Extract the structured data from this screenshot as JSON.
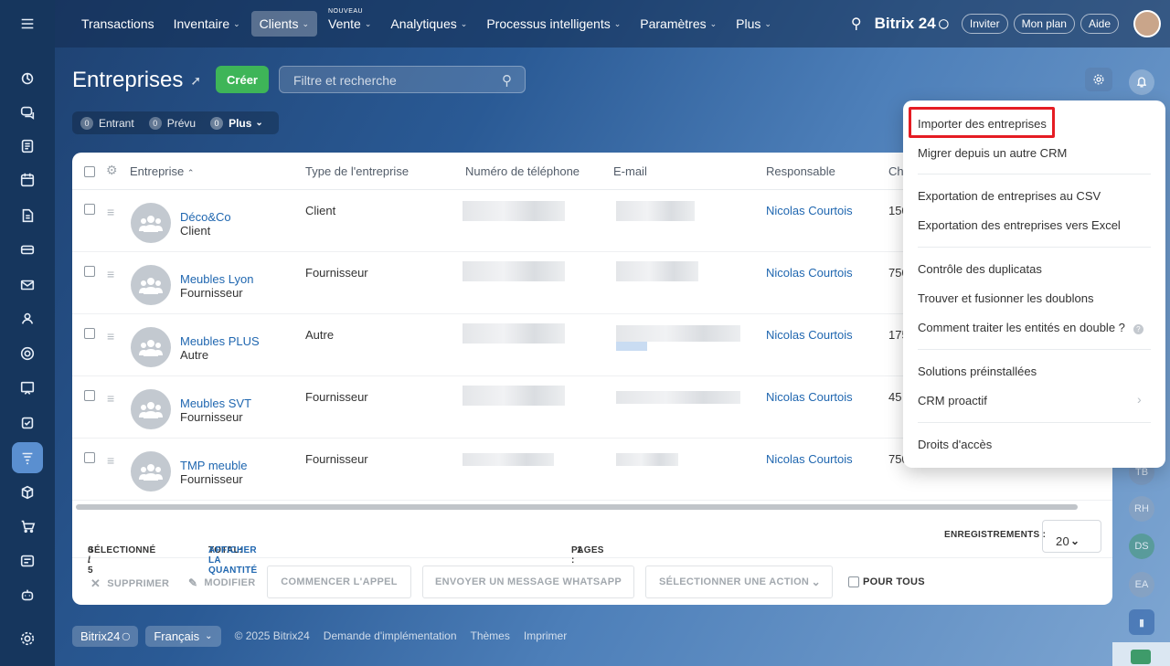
{
  "topnav": {
    "items": [
      {
        "label": "Transactions",
        "chevron": false
      },
      {
        "label": "Inventaire",
        "chevron": true
      },
      {
        "label": "Clients",
        "chevron": true,
        "active": true
      },
      {
        "label": "Vente",
        "chevron": true,
        "badge": "NOUVEAU"
      },
      {
        "label": "Analytiques",
        "chevron": true
      },
      {
        "label": "Processus intelligents",
        "chevron": true
      },
      {
        "label": "Paramètres",
        "chevron": true
      },
      {
        "label": "Plus",
        "chevron": true
      }
    ],
    "brand": "Bitrix 24",
    "invite": "Inviter",
    "plan": "Mon plan",
    "help": "Aide"
  },
  "page": {
    "title": "Entreprises",
    "create_label": "Créer",
    "search_placeholder": "Filtre et recherche",
    "counters": [
      {
        "count": "0",
        "label": "Entrant"
      },
      {
        "count": "0",
        "label": "Prévu"
      },
      {
        "count": "0",
        "label": "Plus"
      }
    ]
  },
  "table": {
    "headers": {
      "company": "Entreprise",
      "type": "Type de l'entreprise",
      "phone": "Numéro de téléphone",
      "email": "E-mail",
      "responsible": "Responsable",
      "extra": "Ch"
    },
    "rows": [
      {
        "name": "Déco&Co",
        "sub": "Client",
        "type": "Client",
        "responsible": "Nicolas Courtois",
        "extra": "150"
      },
      {
        "name": "Meubles Lyon",
        "sub": "Fournisseur",
        "type": "Fournisseur",
        "responsible": "Nicolas Courtois",
        "extra": "750"
      },
      {
        "name": "Meubles PLUS",
        "sub": "Autre",
        "type": "Autre",
        "responsible": "Nicolas Courtois",
        "extra": "175"
      },
      {
        "name": "Meubles SVT",
        "sub": "Fournisseur",
        "type": "Fournisseur",
        "responsible": "Nicolas Courtois",
        "extra": "45"
      },
      {
        "name": "TMP meuble",
        "sub": "Fournisseur",
        "type": "Fournisseur",
        "responsible": "Nicolas Courtois",
        "extra": "750"
      }
    ],
    "footer": {
      "selected_label": "SÉLECTIONNÉ :",
      "selected_value": "0 / 5",
      "total_label": "TOTAL:",
      "total_link": "AFFICHER LA QUANTITÉ",
      "pages_label": "PAGES :",
      "pages_value": "1",
      "records_label": "ENREGISTREMENTS :",
      "records_value": "20"
    },
    "actions": {
      "delete": "SUPPRIMER",
      "edit": "MODIFIER",
      "call": "COMMENCER L'APPEL",
      "whatsapp": "ENVOYER UN MESSAGE WHATSAPP",
      "select_action": "SÉLECTIONNER UNE ACTION",
      "for_all": "POUR TOUS"
    }
  },
  "settings_menu": {
    "items": [
      "Importer des entreprises",
      "Migrer depuis un autre CRM",
      "Exportation de entreprises au CSV",
      "Exportation des entreprises vers Excel",
      "Contrôle des duplicatas",
      "Trouver et fusionner les doublons",
      "Comment traiter les entités en double ?",
      "Solutions préinstallées",
      "CRM proactif",
      "Droits d'accès"
    ]
  },
  "right_rail": {
    "avatars": [
      "TB",
      "RH",
      "DS",
      "EA"
    ]
  },
  "bottom": {
    "brand": "Bitrix24",
    "language": "Français",
    "copyright": "© 2025 Bitrix24",
    "links": [
      "Demande d'implémentation",
      "Thèmes",
      "Imprimer"
    ]
  },
  "colors": {
    "accent_green": "#3eb558",
    "link_blue": "#2067b0",
    "highlight_red": "#e51c23"
  }
}
